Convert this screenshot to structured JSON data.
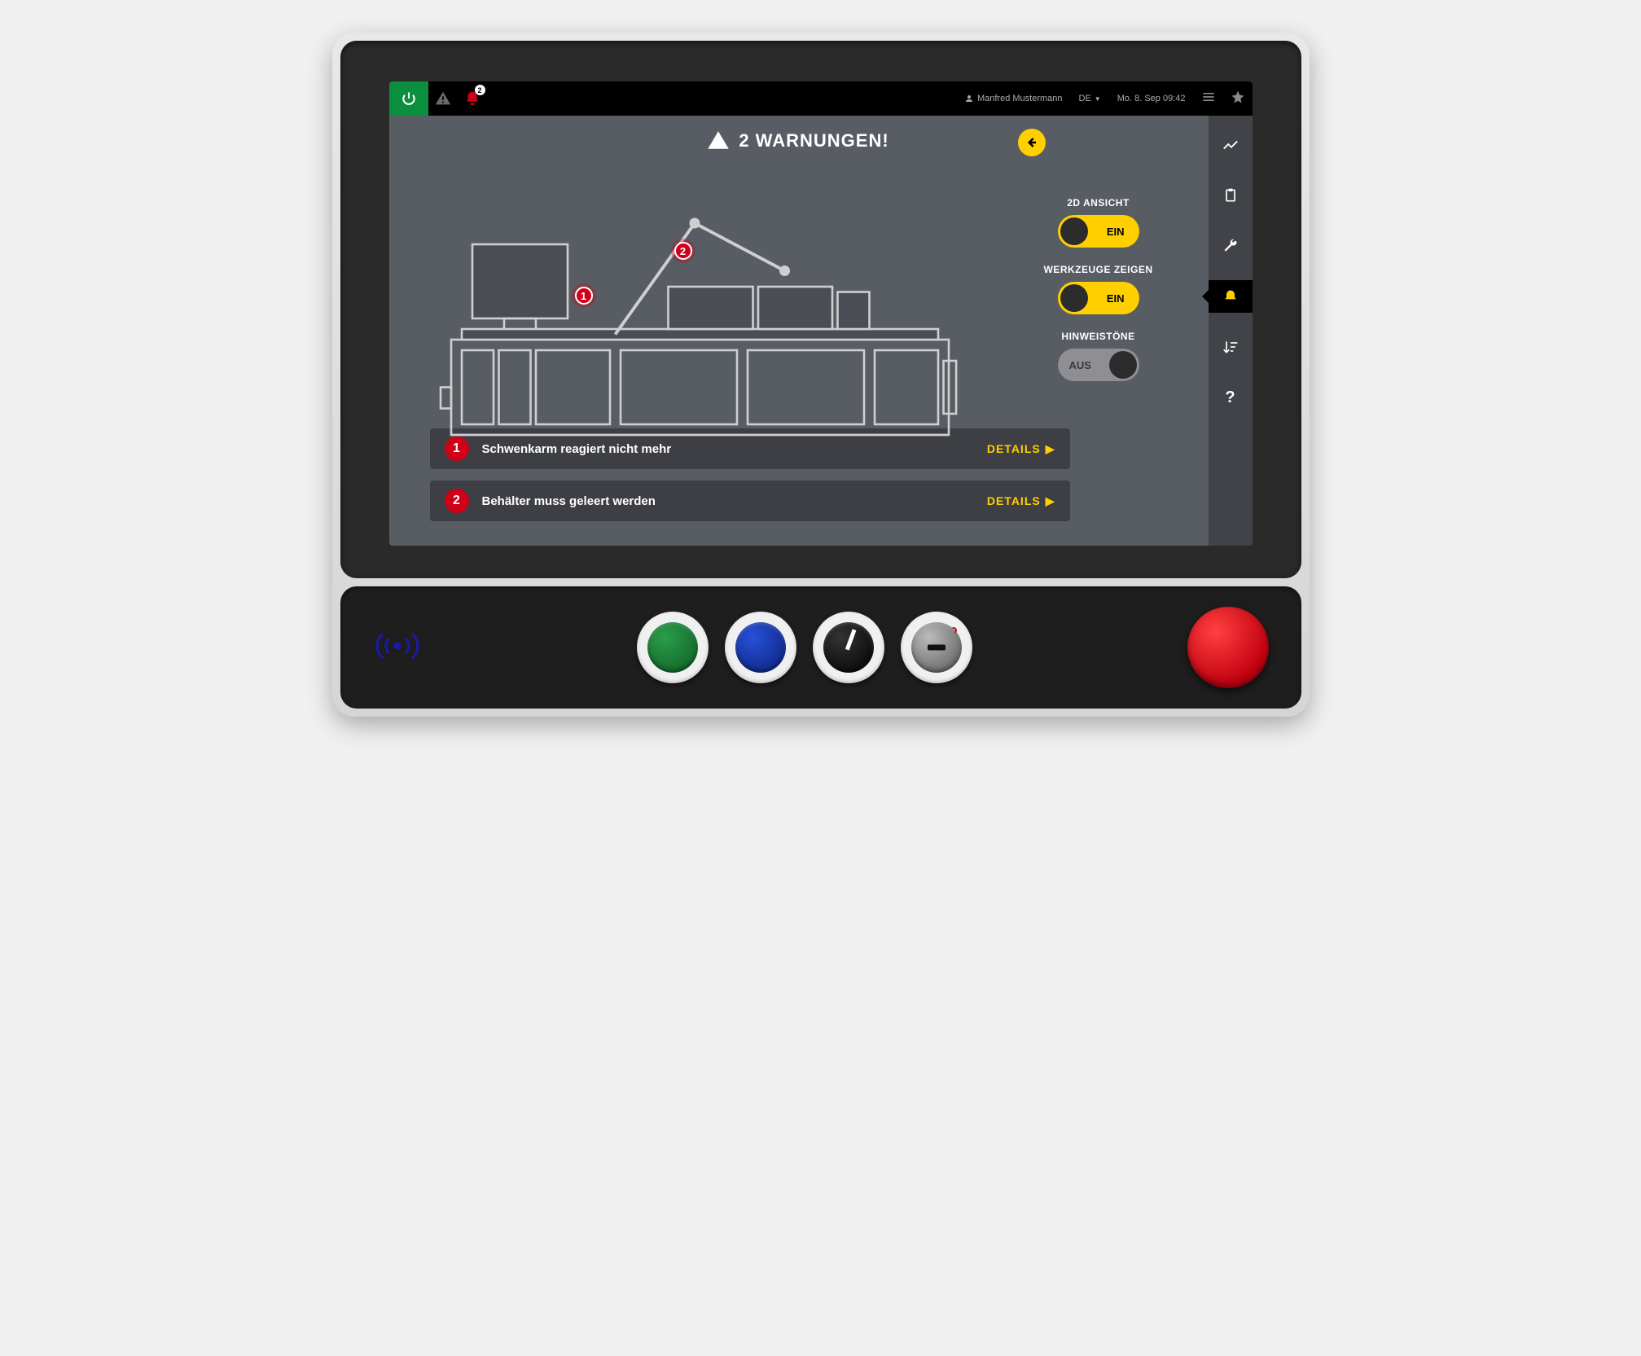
{
  "topbar": {
    "alarm_badge": "2",
    "user": "Manfred Mustermann",
    "lang": "DE",
    "datetime": "Mo. 8. Sep  09:42"
  },
  "header": {
    "title": "2 WARNUNGEN!"
  },
  "toggles": {
    "view2d": {
      "label": "2D ANSICHT",
      "state": "EIN"
    },
    "tools": {
      "label": "WERKZEUGE ZEIGEN",
      "state": "EIN"
    },
    "sounds": {
      "label": "HINWEISTÖNE",
      "state": "AUS"
    }
  },
  "warnings": [
    {
      "num": "1",
      "msg": "Schwenkarm reagiert nicht mehr",
      "action": "DETAILS"
    },
    {
      "num": "2",
      "msg": "Behälter muss geleert werden",
      "action": "DETAILS"
    }
  ],
  "markers": {
    "m1": "1",
    "m2": "2"
  }
}
